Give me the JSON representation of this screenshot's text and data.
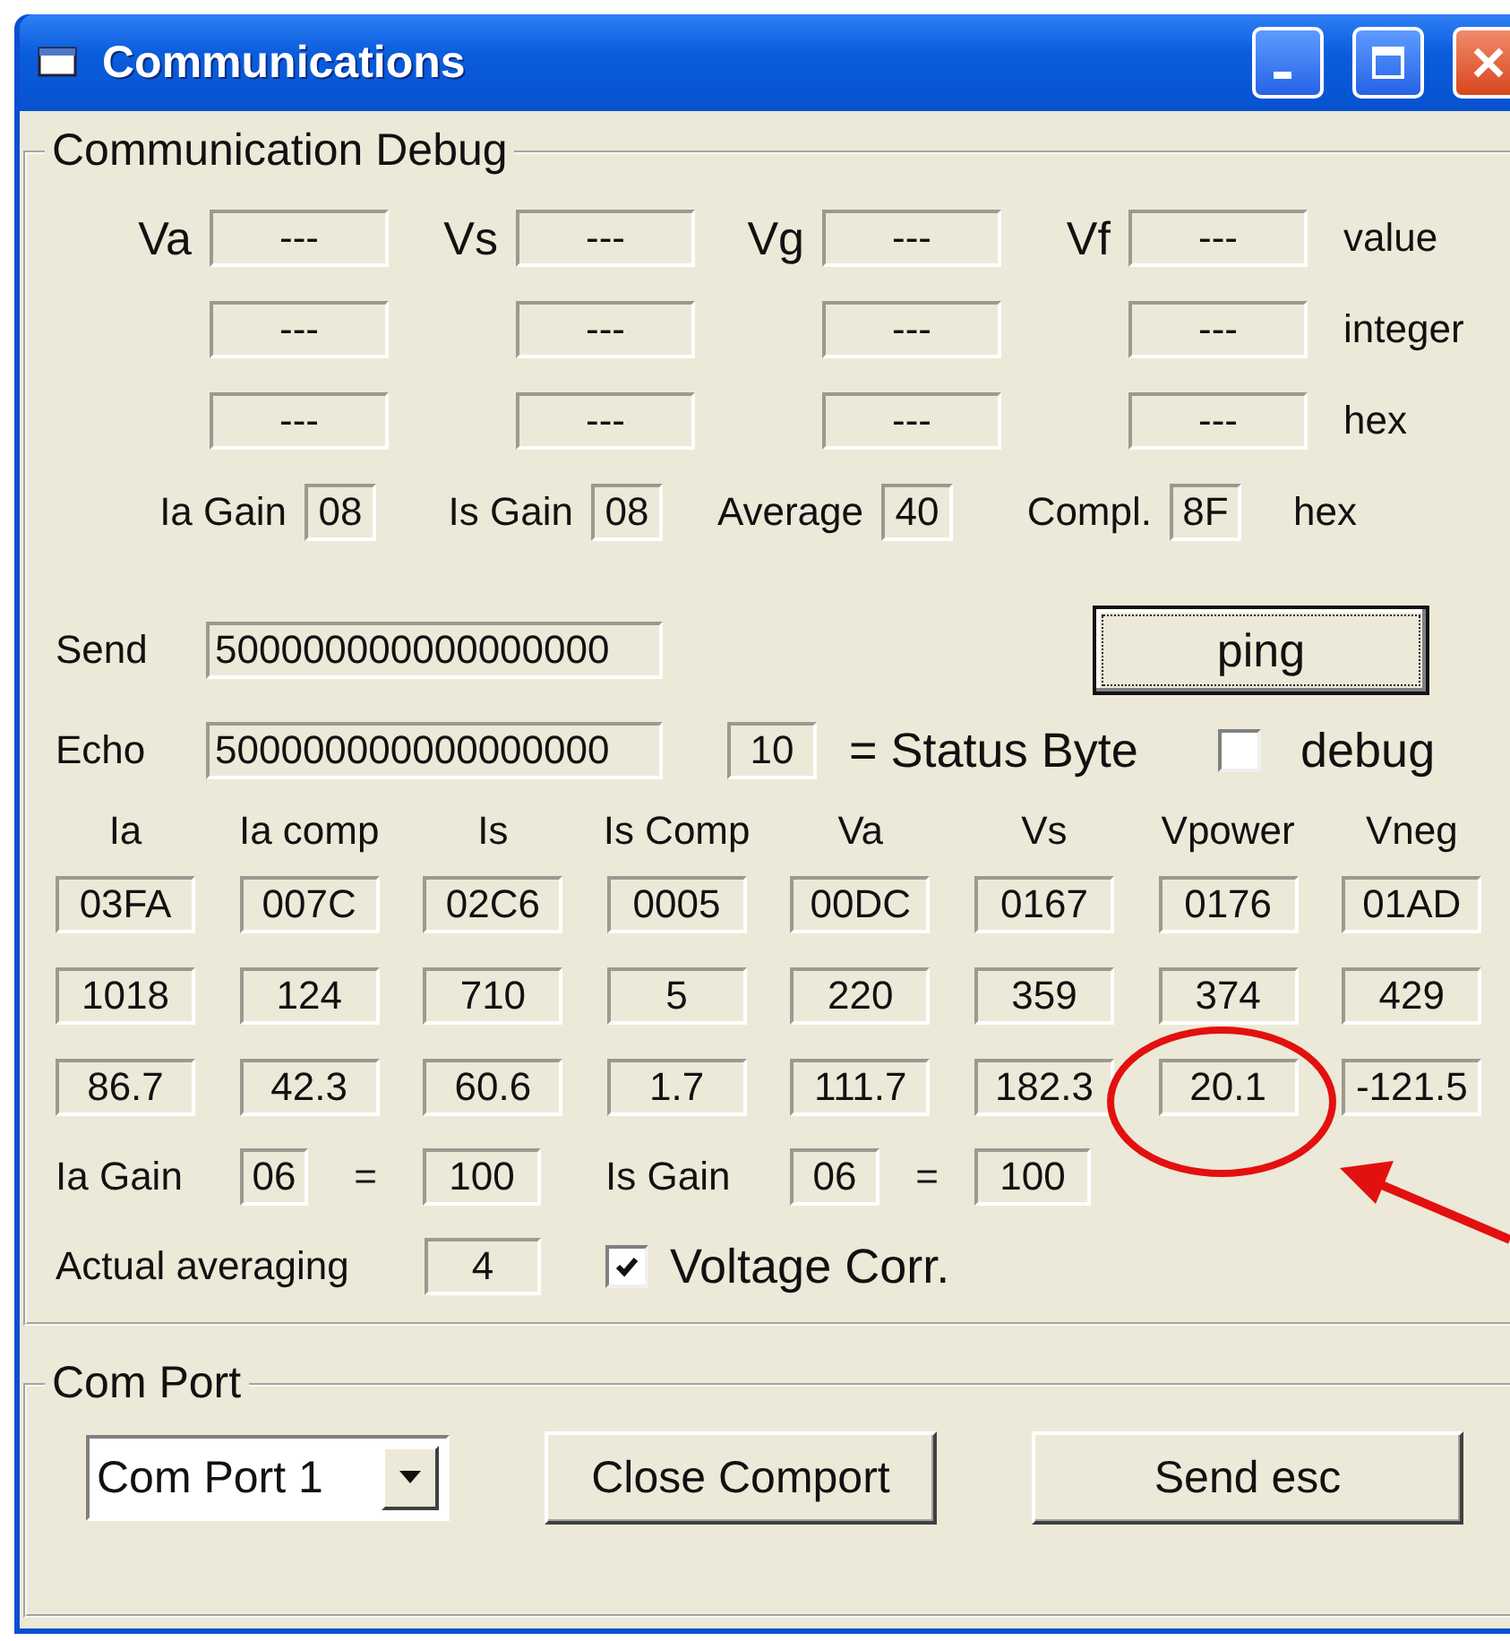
{
  "window": {
    "title": "Communications"
  },
  "debug_group": {
    "title": "Communication Debug",
    "voltage_labels": [
      "Va",
      "Vs",
      "Vg",
      "Vf"
    ],
    "readings": [
      {
        "unit": "value",
        "fields": [
          "---",
          "---",
          "---",
          "---"
        ]
      },
      {
        "unit": "integer",
        "fields": [
          "---",
          "---",
          "---",
          "---"
        ]
      },
      {
        "unit": "hex",
        "fields": [
          "---",
          "---",
          "---",
          "---"
        ]
      }
    ],
    "settings": [
      {
        "label": "Ia Gain",
        "value": "08"
      },
      {
        "label": "Is Gain",
        "value": "08"
      },
      {
        "label": "Average",
        "value": "40"
      },
      {
        "label": "Compl.",
        "value": "8F"
      }
    ],
    "settings_unit": "hex",
    "send": {
      "label": "Send",
      "value": "500000000000000000"
    },
    "ping_button": "ping",
    "echo": {
      "label": "Echo",
      "value": "500000000000000000",
      "status": "10",
      "status_label": "=  Status Byte"
    },
    "debug_checkbox": {
      "label": "debug",
      "checked": false
    },
    "table": {
      "columns": [
        "Ia",
        "Ia comp",
        "Is",
        "Is Comp",
        "Va",
        "Vs",
        "Vpower",
        "Vneg"
      ],
      "rows": [
        [
          "03FA",
          "007C",
          "02C6",
          "0005",
          "00DC",
          "0167",
          "0176",
          "01AD"
        ],
        [
          "1018",
          "124",
          "710",
          "5",
          "220",
          "359",
          "374",
          "429"
        ],
        [
          "86.7",
          "42.3",
          "60.6",
          "1.7",
          "111.7",
          "182.3",
          "20.1",
          "-121.5"
        ]
      ]
    },
    "gains": [
      {
        "label": "Ia Gain",
        "code": "06",
        "equals": "=",
        "value": "100"
      },
      {
        "label": "Is Gain",
        "code": "06",
        "equals": "=",
        "value": "100"
      }
    ],
    "averaging": {
      "label": "Actual averaging",
      "value": "4"
    },
    "voltage_corr": {
      "label": "Voltage Corr.",
      "checked": true
    }
  },
  "com_port_group": {
    "title": "Com Port",
    "port": "Com Port 1",
    "buttons": [
      "Close Comport",
      "Send esc"
    ]
  },
  "annotation": {
    "kind": "circle-arrow"
  }
}
